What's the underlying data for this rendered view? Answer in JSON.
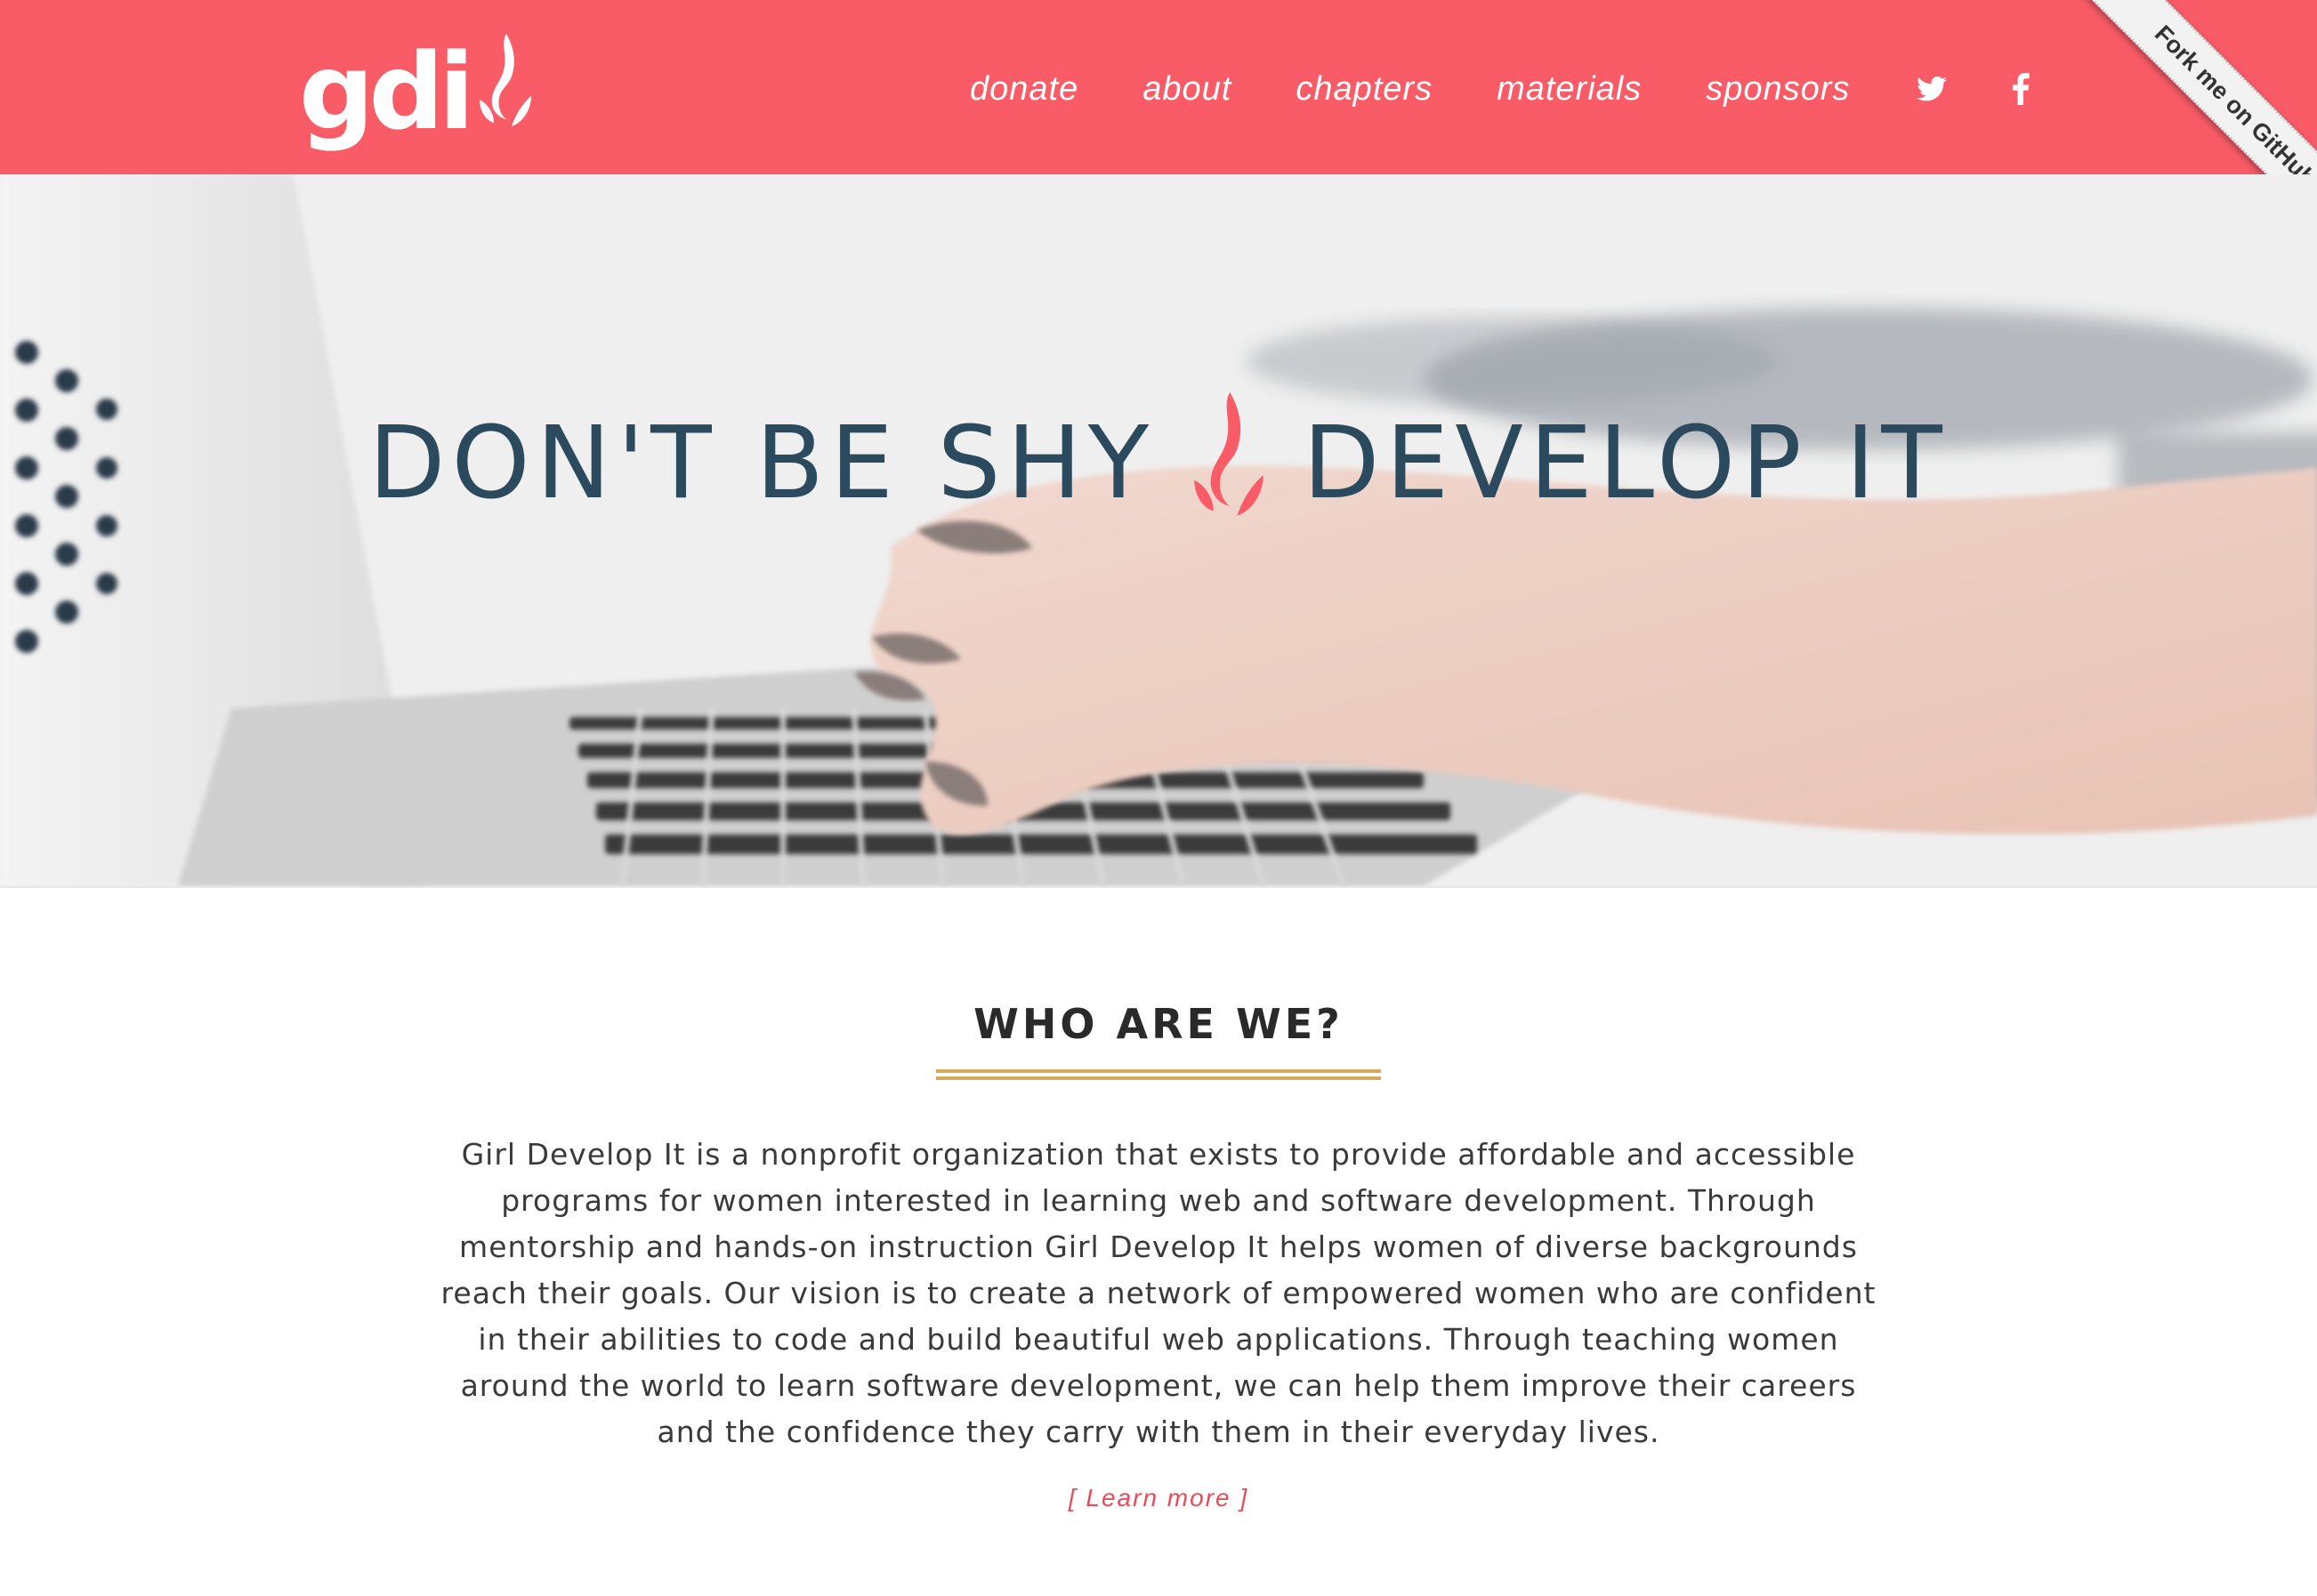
{
  "header": {
    "logo_text": "gdi",
    "nav": [
      "donate",
      "about",
      "chapters",
      "materials",
      "sponsors"
    ],
    "social": [
      "twitter-icon",
      "facebook-icon"
    ],
    "ribbon": "Fork me on GitHub"
  },
  "hero": {
    "title_left": "DON'T BE SHY",
    "title_right": "DEVELOP IT"
  },
  "about": {
    "title": "WHO ARE WE?",
    "text": "Girl Develop It is a nonprofit organization that exists to provide affordable and accessible programs for women interested in learning web and software development. Through mentorship and hands-on instruction Girl Develop It helps women of diverse backgrounds reach their goals. Our vision is to create a network of empowered women who are confident in their abilities to code and build beautiful web applications. Through teaching women around the world to learn software development, we can help them improve their careers and the confidence they carry with them in their everyday lives.",
    "learn_more": "[ Learn more ]"
  },
  "colors": {
    "brand": "#f95c66",
    "heading": "#2c4a5e",
    "accent_gold": "#d6a95a"
  }
}
